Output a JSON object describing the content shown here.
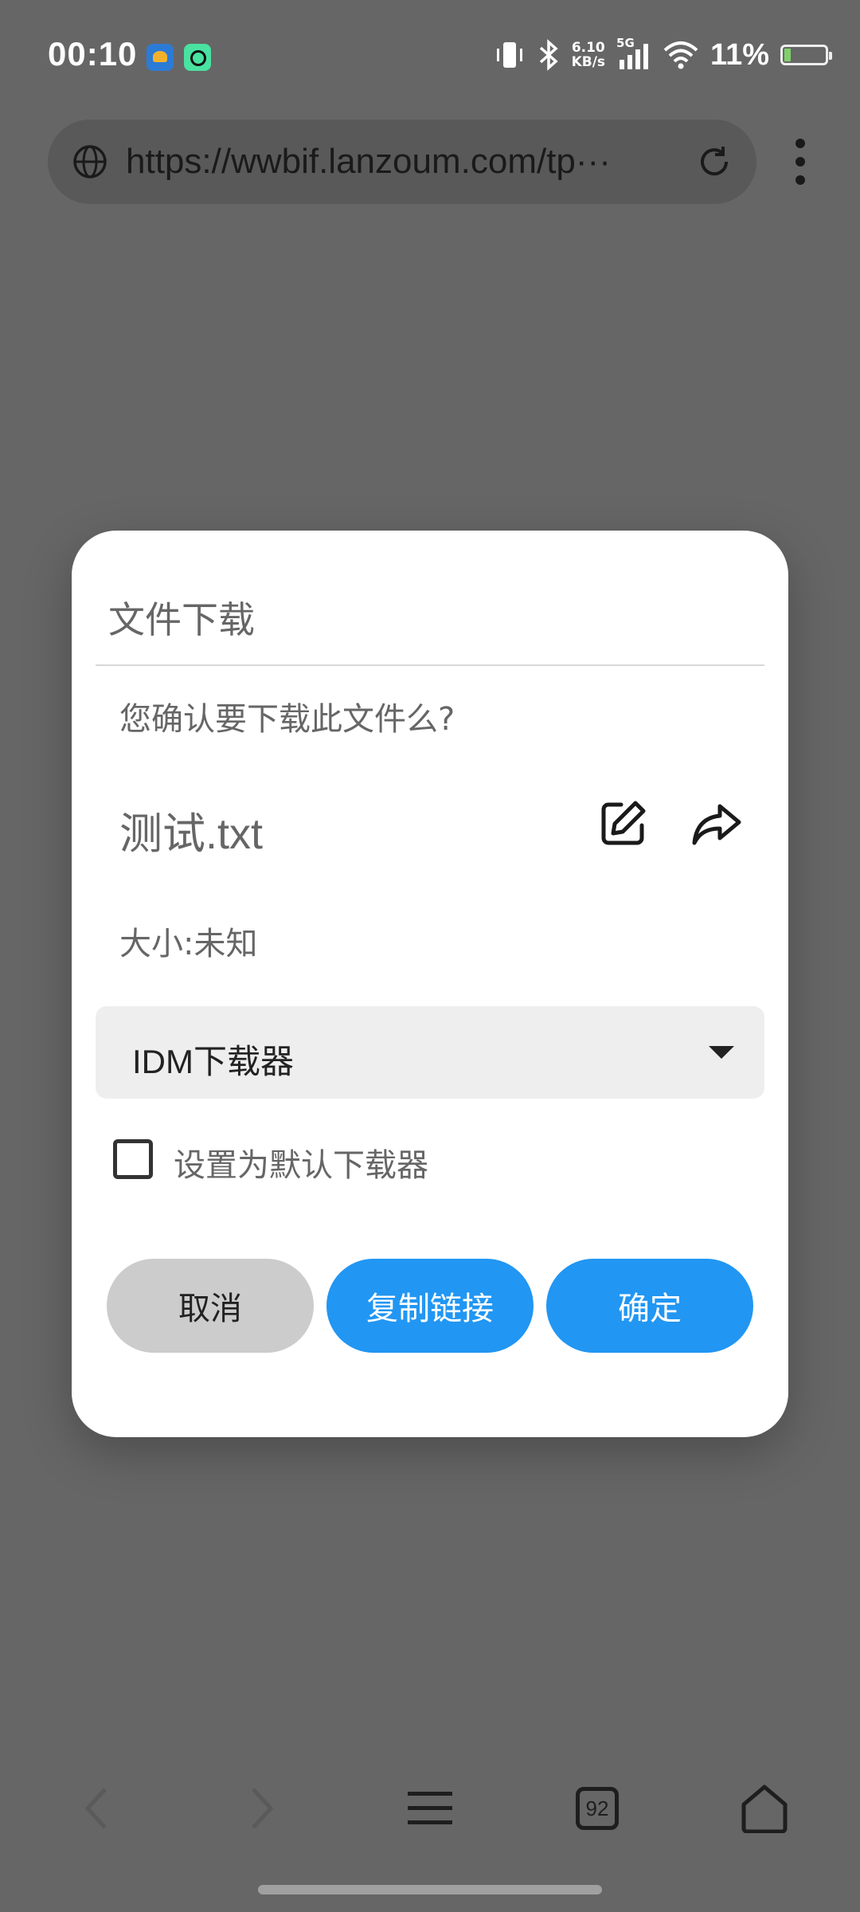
{
  "status_bar": {
    "time": "00:10",
    "net_speed_value": "6.10",
    "net_speed_unit": "KB/s",
    "network_type": "5G",
    "battery_percent": "11%",
    "icons": [
      "app-notification-icon",
      "chat-app-icon",
      "vibrate-icon",
      "bluetooth-icon",
      "signal-icon",
      "wifi-icon",
      "battery-icon"
    ]
  },
  "browser": {
    "url": "https://wwbif.lanzoum.com/tp···"
  },
  "dialog": {
    "title": "文件下载",
    "confirm_text": "您确认要下载此文件么?",
    "file_name": "测试.txt",
    "size_text": "大小:未知",
    "downloader": {
      "selected": "IDM下载器"
    },
    "default_checkbox": {
      "label": "设置为默认下载器",
      "checked": false
    },
    "buttons": {
      "cancel": "取消",
      "copy_link": "复制链接",
      "confirm": "确定"
    }
  },
  "bottom_nav": {
    "tab_count": "92"
  },
  "colors": {
    "accent": "#2196f3",
    "overlay": "#666666",
    "cancel_button": "#cccccc"
  }
}
